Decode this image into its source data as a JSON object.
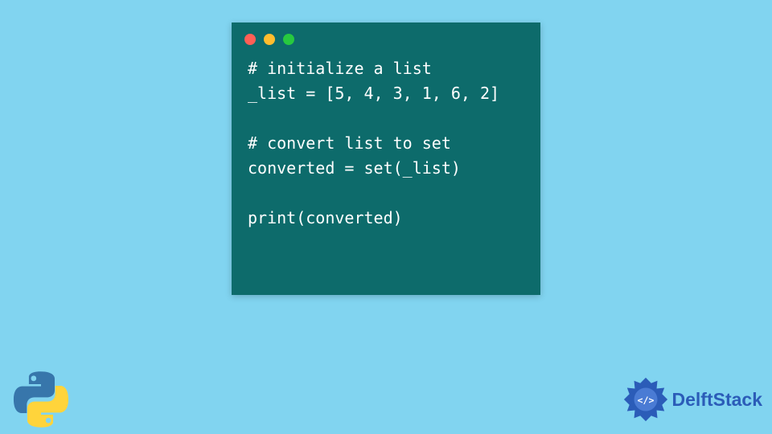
{
  "code_window": {
    "traffic_lights": {
      "red": "#ff5f56",
      "yellow": "#ffbd2e",
      "green": "#27c93f"
    },
    "lines": [
      "# initialize a list",
      "_list = [5, 4, 3, 1, 6, 2]",
      "",
      "# convert list to set",
      "converted = set(_list)",
      "",
      "print(converted)"
    ]
  },
  "logos": {
    "python": "python-logo",
    "delftstack_text": "DelftStack"
  },
  "colors": {
    "background": "#81d4f0",
    "window_bg": "#0d6b6b",
    "code_text": "#ffffff",
    "brand_blue": "#2b5cb8"
  }
}
